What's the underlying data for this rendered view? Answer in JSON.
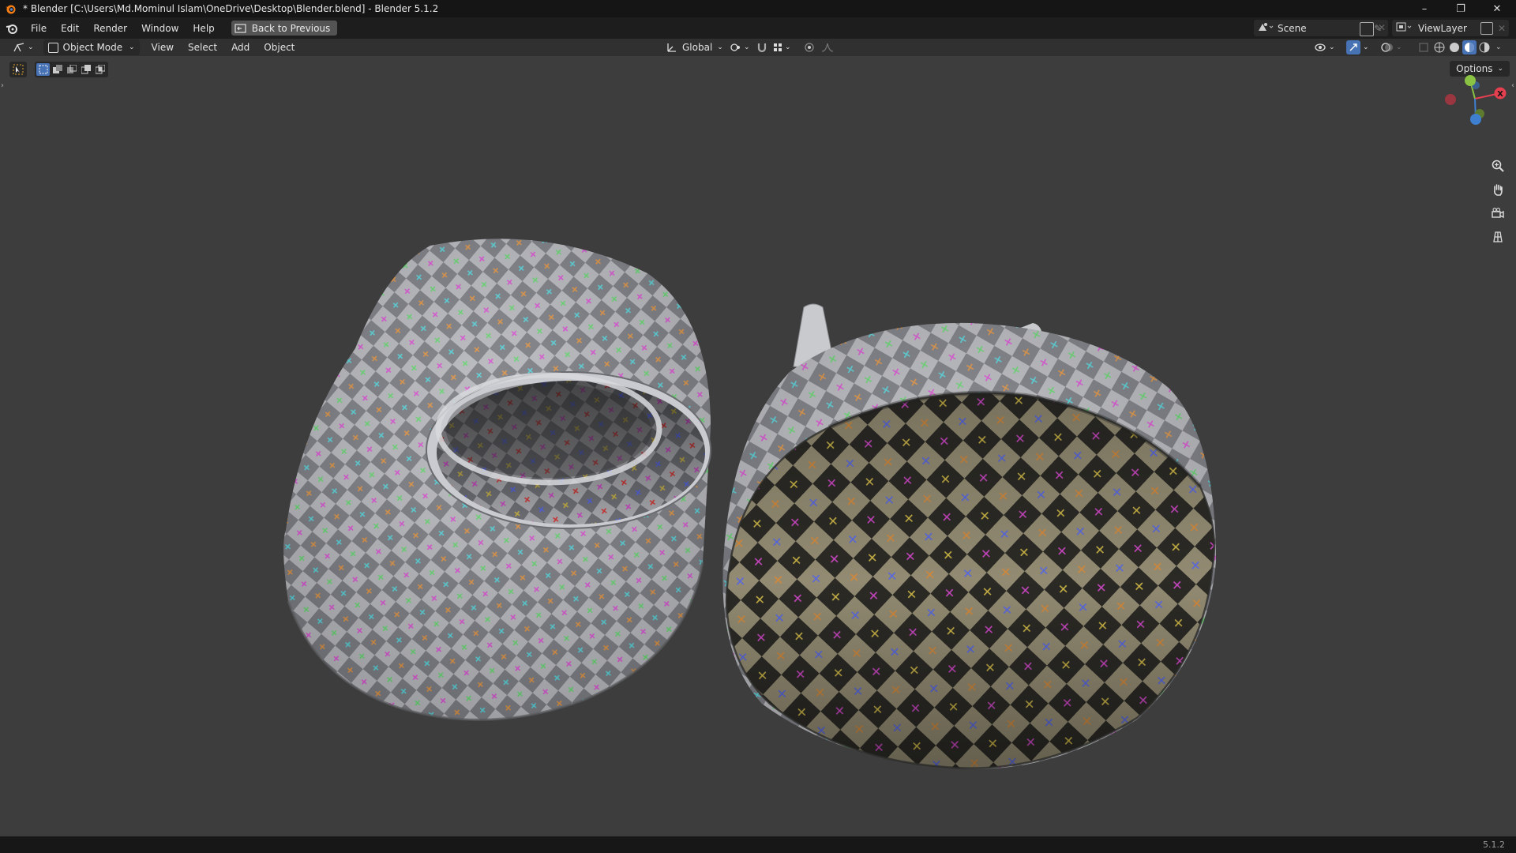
{
  "window": {
    "title": "* Blender [C:\\Users\\Md.Mominul Islam\\OneDrive\\Desktop\\Blender.blend] - Blender 5.1.2",
    "controls": [
      "–",
      "❐",
      "✕"
    ]
  },
  "menubar": {
    "items": [
      "File",
      "Edit",
      "Render",
      "Window",
      "Help"
    ],
    "back_button": "Back to Previous",
    "scene_label": "Scene",
    "viewlayer_label": "ViewLayer"
  },
  "header": {
    "mode": "Object Mode",
    "menus": [
      "View",
      "Select",
      "Add",
      "Object"
    ],
    "orientation": "Global",
    "options": "Options"
  },
  "gizmo": {
    "x_label": "X",
    "colors": {
      "x": "#e4404f",
      "y": "#8ac244",
      "z": "#3f7fcf"
    }
  },
  "viewport": {
    "background": "#3d3d3d",
    "objects": [
      "checker-cylinder-open",
      "checker-cylinder-closed"
    ],
    "checker_light": "#b4b5ba",
    "checker_dark": "#77797f",
    "marker_colors": [
      "#e08f3a",
      "#5fd46a",
      "#5a6cf0",
      "#d84ad0",
      "#4fd1d8",
      "#e03a3a",
      "#d8c04a"
    ]
  },
  "statusbar": {
    "version": "5.1.2"
  }
}
